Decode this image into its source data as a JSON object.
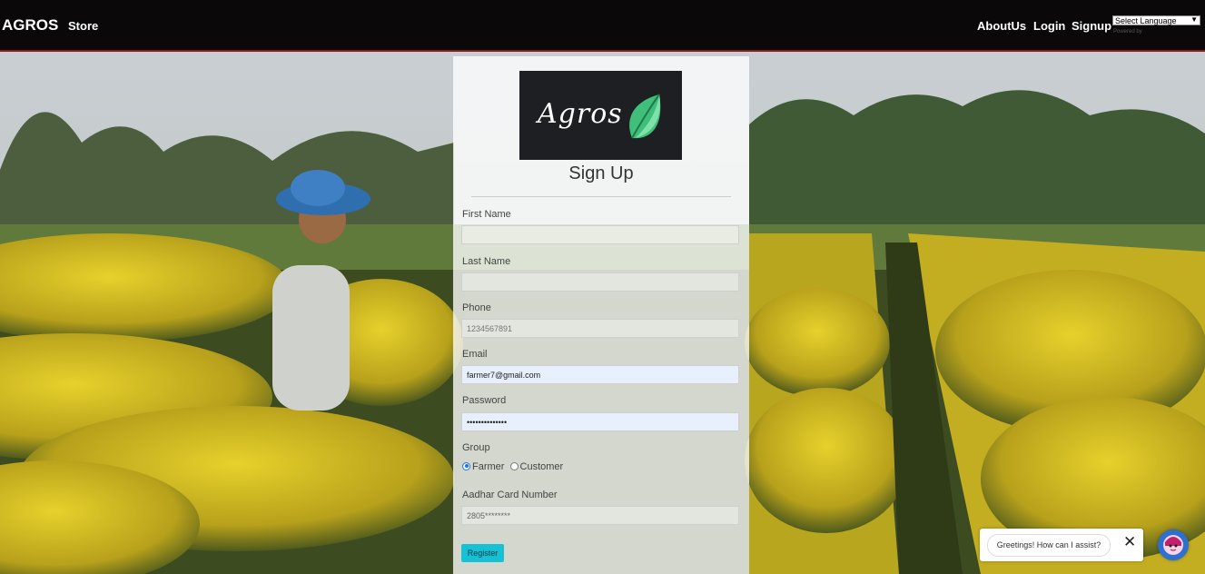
{
  "navbar": {
    "brand": "AGROS",
    "store": "Store",
    "about": "AboutUs",
    "login": "Login",
    "signup": "Signup",
    "language_select": "Select Language",
    "powered_by": "Powered by"
  },
  "form": {
    "logo_text": "Agros",
    "title": "Sign Up",
    "first_name_label": "First Name",
    "first_name_value": "",
    "last_name_label": "Last Name",
    "last_name_value": "",
    "phone_label": "Phone",
    "phone_placeholder": "1234567891",
    "email_label": "Email",
    "email_value": "farmer7@gmail.com",
    "password_label": "Password",
    "password_value": "••••••••••••••",
    "group_label": "Group",
    "group_options": [
      "Farmer",
      "Customer"
    ],
    "group_selected": "Farmer",
    "aadhar_label": "Aadhar Card Number",
    "aadhar_value": "2805********",
    "register_label": "Register"
  },
  "chat": {
    "greeting": "Greetings! How can I assist?",
    "close_icon": "close-icon",
    "avatar_icon": "chatbot-avatar-icon"
  },
  "colors": {
    "navbar_bg": "#0a0809",
    "navbar_border": "#8b1a1a",
    "register_button": "#17c1d4",
    "chat_avatar": "#2f6fd0"
  }
}
